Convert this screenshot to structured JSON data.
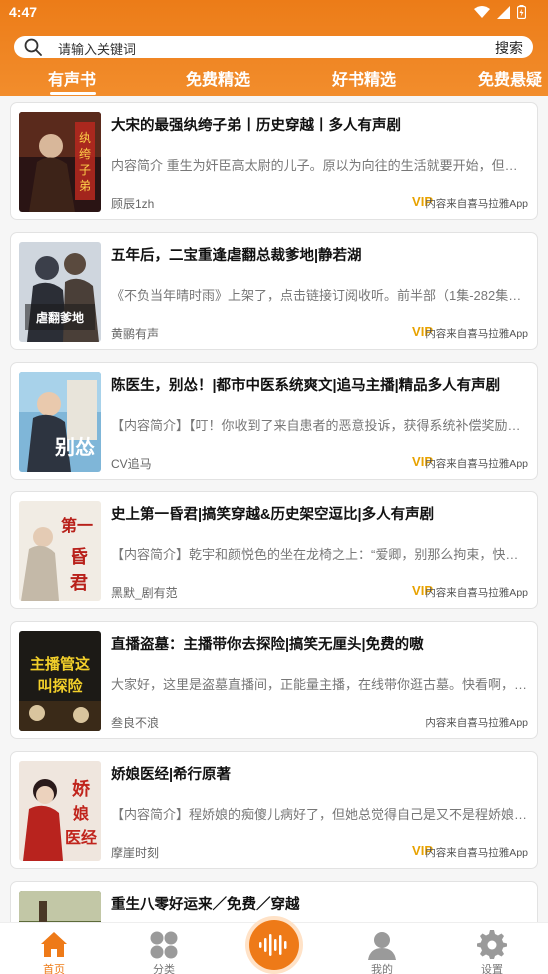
{
  "status": {
    "time": "4:47"
  },
  "search": {
    "placeholder": "请输入关键词",
    "button": "搜索"
  },
  "tabs": [
    {
      "label": "有声书",
      "active": true
    },
    {
      "label": "免费精选"
    },
    {
      "label": "好书精选"
    },
    {
      "label": "免费悬疑"
    }
  ],
  "books": [
    {
      "title": "大宋的最强纨绔子弟丨历史穿越丨多人有声剧",
      "desc": "内容简介 重生为奸臣高太尉的儿子。原以为向往的生活就要开始，但是…",
      "author": "顾辰1zh",
      "vip": "VIP",
      "source": "内容来自喜马拉雅App",
      "cover_text": "纨绔子弟"
    },
    {
      "title": "五年后，二宝重逢虐翻总裁爹地|静若湖",
      "desc": "《不负当年晴时雨》上架了，点击链接订阅收听。前半部（1集-282集）…",
      "author": "黄鹂有声",
      "vip": "VIP",
      "source": "内容来自喜马拉雅App",
      "cover_text": "二宝重逢虐翻总裁爹地"
    },
    {
      "title": "陈医生，别怂！|都市中医系统爽文|追马主播|精品多人有声剧",
      "desc": "【内容简介】【叮！你收到了来自患者的恶意投诉，获得系统补偿奖励！…",
      "author": "CV追马",
      "vip": "VIP",
      "source": "内容来自喜马拉雅App",
      "cover_text": "陈医生别怂"
    },
    {
      "title": "史上第一昏君|搞笑穿越&历史架空逗比|多人有声剧",
      "desc": "【内容简介】乾宇和颜悦色的坐在龙椅之上：“爱卿，别那么拘束，快坐…",
      "author": "黑默_剧有范",
      "vip": "VIP",
      "source": "内容来自喜马拉雅App",
      "cover_text": "第一昏君"
    },
    {
      "title": "直播盗墓：主播带你去探险|搞笑无厘头|免费的嗷",
      "desc": "大家好，这里是盗墓直播间，正能量主播，在线带你逛古墓。快看啊，墓…",
      "author": "叁良不浪",
      "vip": "",
      "source": "内容来自喜马拉雅App",
      "cover_text": "主播管这叫探险"
    },
    {
      "title": "娇娘医经|希行原著",
      "desc": "【内容简介】程娇娘的痴傻儿病好了，但她总觉得自己是又不是程娇娘，…",
      "author": "摩崖时刻",
      "vip": "VIP",
      "source": "内容来自喜马拉雅App",
      "cover_text": "娇娘医经"
    },
    {
      "title": "重生八零好运来／免费／穿越",
      "desc": "",
      "author": "",
      "vip": "",
      "source": "",
      "cover_text": ""
    }
  ],
  "nav": [
    {
      "label": "首页",
      "icon": "home-icon",
      "active": true
    },
    {
      "label": "分类",
      "icon": "category-icon"
    },
    {
      "label": "",
      "icon": "audio-wave-icon"
    },
    {
      "label": "我的",
      "icon": "user-icon"
    },
    {
      "label": "设置",
      "icon": "gear-icon"
    }
  ],
  "colors": {
    "accent": "#ee7a18",
    "vip": "#e8a200"
  }
}
